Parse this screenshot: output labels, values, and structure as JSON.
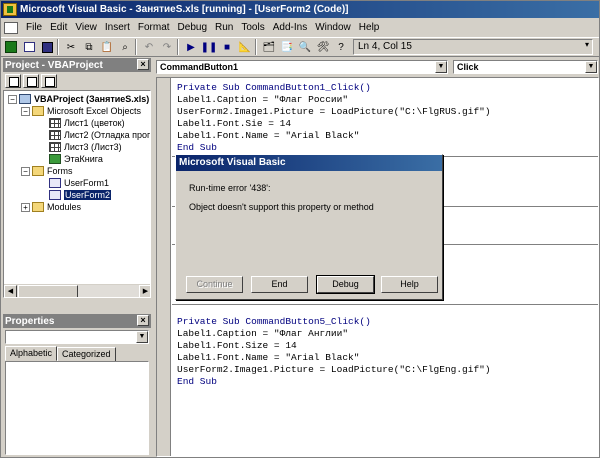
{
  "titlebar": {
    "title": "Microsoft Visual Basic - ЗанятиеS.xls [running] - [UserForm2 (Code)]",
    "minimize": "_",
    "restore": "▫",
    "close": "×"
  },
  "menubar": {
    "items": [
      "File",
      "Edit",
      "View",
      "Insert",
      "Format",
      "Debug",
      "Run",
      "Tools",
      "Add-Ins",
      "Window",
      "Help"
    ]
  },
  "toolbar": {
    "position_label": "Ln 4, Col 15"
  },
  "project_panel": {
    "title": "Project - VBAProject",
    "close": "×",
    "tree": [
      {
        "label": "VBAProject (ЗанятиеS.xls)",
        "indent": 0,
        "expander": "−",
        "icon": "project-icon"
      },
      {
        "label": "Microsoft Excel Objects",
        "indent": 1,
        "expander": "−",
        "icon": "folder-icon"
      },
      {
        "label": "Лист1 (цветок)",
        "indent": 2,
        "expander": "",
        "icon": "sheet-icon"
      },
      {
        "label": "Лист2 (Отладка прог",
        "indent": 2,
        "expander": "",
        "icon": "sheet-icon"
      },
      {
        "label": "Лист3 (Лист3)",
        "indent": 2,
        "expander": "",
        "icon": "sheet-icon"
      },
      {
        "label": "ЭтаКнига",
        "indent": 2,
        "expander": "",
        "icon": "workbook-icon"
      },
      {
        "label": "Forms",
        "indent": 1,
        "expander": "−",
        "icon": "folder-icon"
      },
      {
        "label": "UserForm1",
        "indent": 2,
        "expander": "",
        "icon": "form-icon"
      },
      {
        "label": "UserForm2",
        "indent": 2,
        "expander": "",
        "icon": "form-icon",
        "selected": true
      },
      {
        "label": "Modules",
        "indent": 1,
        "expander": "+",
        "icon": "folder-icon"
      }
    ]
  },
  "properties_panel": {
    "title": "Properties",
    "close": "×",
    "tabs": [
      "Alphabetic",
      "Categorized"
    ]
  },
  "code_window": {
    "object_combo": "CommandButton1",
    "procedure_combo": "Click",
    "block1": [
      "Private Sub CommandButton1_Click()",
      "Label1.Caption = \"Флаг России\"",
      "UserForm2.Image1.Picture = LoadPicture(\"C:\\FlgRUS.gif\")",
      "Label1.Font.Sie = 14",
      "Label1.Font.Name = \"Arial Black\"",
      "End Sub"
    ],
    "block2": [
      "Private Sub CommandButton5_Click()",
      "Label1.Caption = \"Флаг Англии\"",
      "Label1.Font.Size = 14",
      "Label1.Font.Name = \"Arial Black\"",
      "UserForm2.Image1.Picture = LoadPicture(\"C:\\FlgEng.gif\")",
      "End Sub"
    ]
  },
  "dialog": {
    "title": "Microsoft Visual Basic",
    "error_line": "Run-time error '438':",
    "message": "Object doesn't support this property or method",
    "buttons": {
      "continue": "Continue",
      "end": "End",
      "debug": "Debug",
      "help": "Help"
    }
  }
}
